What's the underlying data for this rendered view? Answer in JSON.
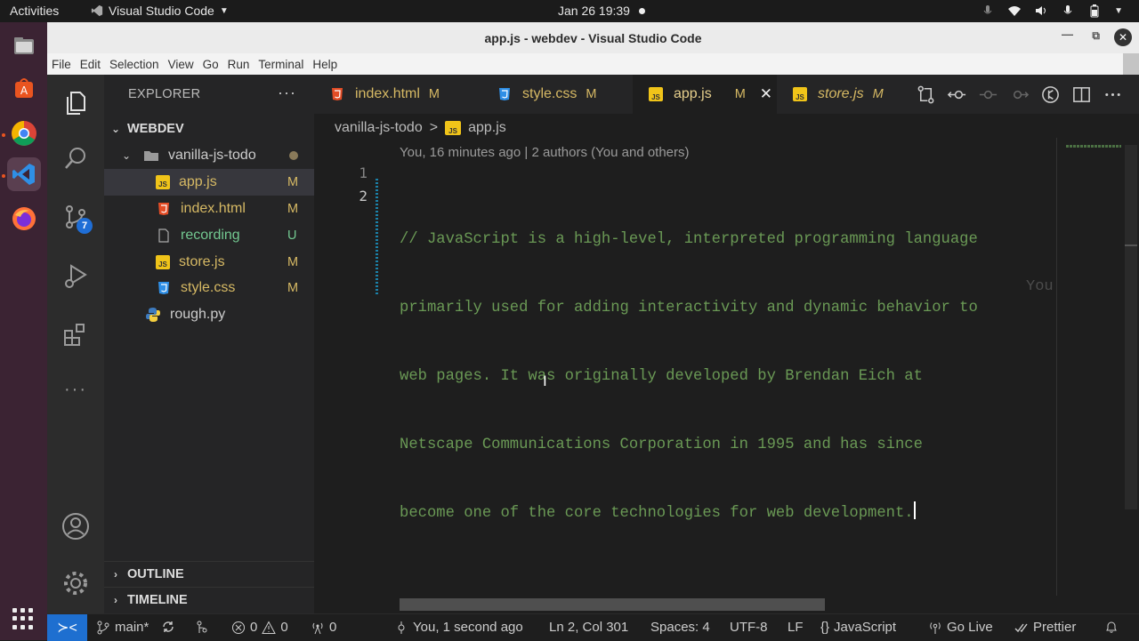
{
  "gnome": {
    "activities": "Activities",
    "app_name": "Visual Studio Code",
    "clock": "Jan 26  19:39"
  },
  "window": {
    "title": "app.js - webdev - Visual Studio Code"
  },
  "menu": [
    "File",
    "Edit",
    "Selection",
    "View",
    "Go",
    "Run",
    "Terminal",
    "Help"
  ],
  "activity_bar": {
    "source_control_badge": "7"
  },
  "sidebar": {
    "header": "EXPLORER",
    "more": "···",
    "root": "WEBDEV",
    "folder": "vanilla-js-todo",
    "files": [
      {
        "name": "app.js",
        "status": "M",
        "icon": "js"
      },
      {
        "name": "index.html",
        "status": "M",
        "icon": "html"
      },
      {
        "name": "recording",
        "status": "U",
        "icon": "file"
      },
      {
        "name": "store.js",
        "status": "M",
        "icon": "js"
      },
      {
        "name": "style.css",
        "status": "M",
        "icon": "css"
      }
    ],
    "root_file": "rough.py",
    "outline": "OUTLINE",
    "timeline": "TIMELINE"
  },
  "tabs": [
    {
      "label": "index.html",
      "status": "M",
      "icon": "html"
    },
    {
      "label": "style.css",
      "status": "M",
      "icon": "css"
    },
    {
      "label": "app.js",
      "status": "M",
      "icon": "js"
    },
    {
      "label": "store.js",
      "status": "M",
      "icon": "js"
    }
  ],
  "breadcrumb": {
    "folder": "vanilla-js-todo",
    "separator": ">",
    "file": "app.js"
  },
  "editor": {
    "codelens": "You, 16 minutes ago | 2 authors (You and others)",
    "line_numbers": [
      "1",
      "2"
    ],
    "code_lines": [
      "// JavaScript is a high-level, interpreted programming language",
      "primarily used for adding interactivity and dynamic behavior to",
      "web pages. It was originally developed by Brendan Eich at",
      "Netscape Communications Corporation in 1995 and has since",
      "become one of the core technologies for web development."
    ],
    "inline_blame": "You"
  },
  "status_bar": {
    "branch": "main*",
    "errors": "0",
    "warnings": "0",
    "ports": "0",
    "blame": "You, 1 second ago",
    "position": "Ln 2, Col 301",
    "spaces": "Spaces: 4",
    "encoding": "UTF-8",
    "eol": "LF",
    "language": "JavaScript",
    "go_live": "Go Live",
    "prettier": "Prettier"
  },
  "colors": {
    "accent": "#1e6fd0",
    "comment": "#6a9955",
    "modified": "#d6b964",
    "untracked": "#73c991"
  }
}
